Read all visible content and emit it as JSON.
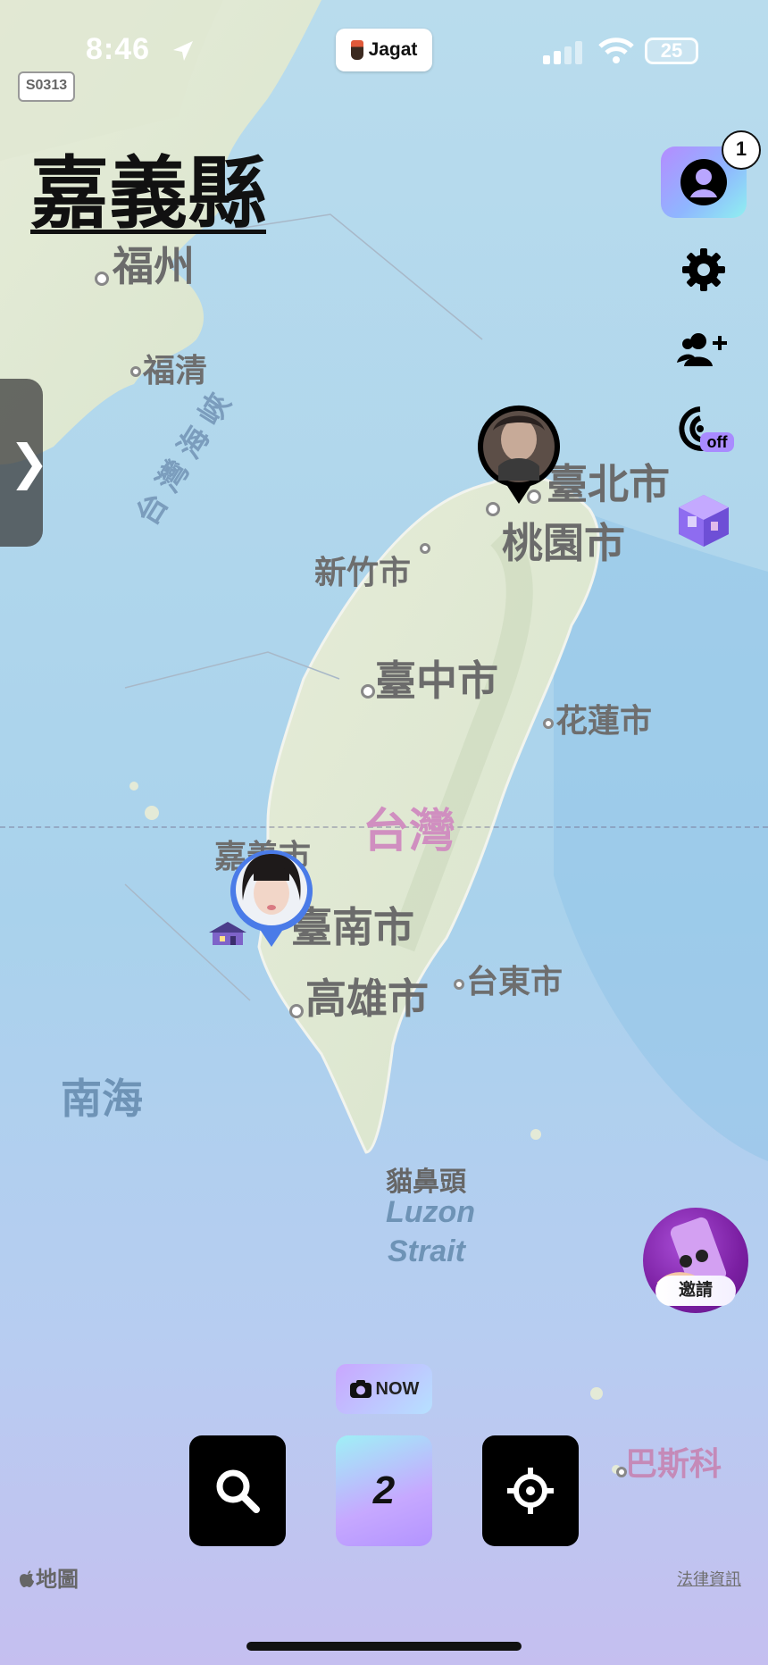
{
  "status_bar": {
    "time": "8:46",
    "app_name": "Jagat",
    "battery": "25"
  },
  "tag": "S0313",
  "header": {
    "title": "嘉義縣"
  },
  "profile": {
    "badge": "1"
  },
  "side_icons": [
    "gear-icon",
    "add-friends-icon",
    "ghost-mode-off-icon",
    "room-cube-icon"
  ],
  "ghost_label": "off",
  "map_labels": {
    "fuzhou": "福州",
    "fuqing": "福清",
    "strait": "台灣海峽",
    "taipei": "臺北市",
    "taoyuan": "桃園市",
    "hsinchu": "新竹市",
    "taichung": "臺中市",
    "hualien": "花蓮市",
    "taiwan": "台灣",
    "chiayi": "嘉義市",
    "tainan": "臺南市",
    "kaohsiung": "高雄市",
    "taitung": "台東市",
    "south_sea": "南海",
    "maobitou": "貓鼻頭",
    "luzon_1": "Luzon",
    "luzon_2": "Strait",
    "bashi": "巴斯科"
  },
  "bottom": {
    "now_label": "NOW",
    "count": "2",
    "invite_label": "邀請"
  },
  "footer": {
    "maps_label": "地圖",
    "legal": "法律資訊"
  }
}
